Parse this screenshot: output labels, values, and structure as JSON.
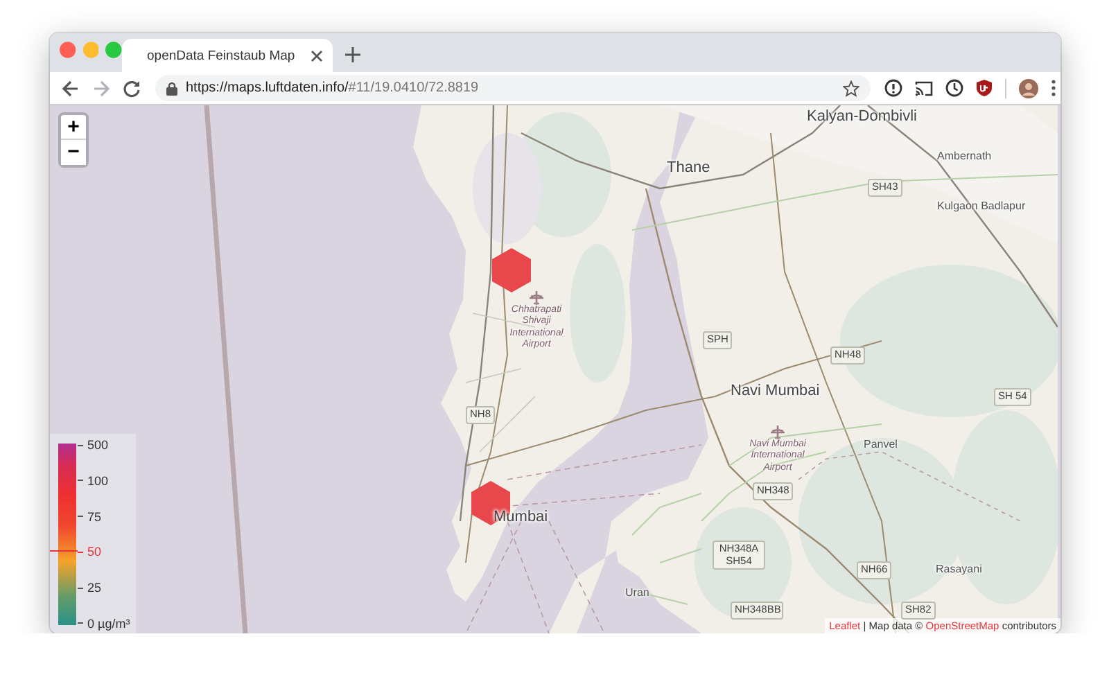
{
  "window": {
    "tab_title": "openData Feinstaub Map",
    "url_host": "https://maps.luftdaten.info/",
    "url_path": "#11/19.0410/72.8819"
  },
  "nav_buttons": [
    {
      "kind": "back",
      "disabled": false
    },
    {
      "kind": "forward",
      "disabled": true
    },
    {
      "kind": "reload",
      "disabled": false
    }
  ],
  "map": {
    "zoom_in": "+",
    "zoom_out": "−",
    "places": [
      {
        "kind": "city",
        "text": "Kalyan-Dombivli"
      },
      {
        "kind": "city",
        "text": "Thane"
      },
      {
        "kind": "town",
        "text": "Ambernath"
      },
      {
        "kind": "road",
        "text": "SH43"
      },
      {
        "kind": "town",
        "text": "Kulgaon Badlapur"
      },
      {
        "kind": "airport",
        "text": "Chhatrapati Shivaji International Airport"
      },
      {
        "kind": "road",
        "text": "SPH"
      },
      {
        "kind": "road",
        "text": "NH48"
      },
      {
        "kind": "city",
        "text": "Navi Mumbai"
      },
      {
        "kind": "road",
        "text": "SH 54"
      },
      {
        "kind": "road",
        "text": "NH8"
      },
      {
        "kind": "town",
        "text": "Panvel"
      },
      {
        "kind": "airport",
        "text": "Navi Mumbai International Airport"
      },
      {
        "kind": "road",
        "text": "NH348"
      },
      {
        "kind": "city",
        "text": "Mumbai"
      },
      {
        "kind": "road",
        "text": "NH348A SH54"
      },
      {
        "kind": "town",
        "text": "Uran"
      },
      {
        "kind": "road",
        "text": "NH66"
      },
      {
        "kind": "town",
        "text": "Rasayani"
      },
      {
        "kind": "road",
        "text": "NH348BB"
      },
      {
        "kind": "road",
        "text": "SH82"
      }
    ],
    "markers": [
      {
        "color": "#e8474c"
      },
      {
        "color": "#e8474c"
      }
    ],
    "legend": {
      "ticks": [
        {
          "label": "500",
          "selected": false
        },
        {
          "label": "100",
          "selected": false
        },
        {
          "label": "75",
          "selected": false
        },
        {
          "label": "50",
          "selected": true
        },
        {
          "label": "25",
          "selected": false
        },
        {
          "label": "0 µg/m³",
          "selected": false
        }
      ]
    },
    "attribution": [
      {
        "text": "Leaflet",
        "link": true
      },
      {
        "text": "| Map data ©",
        "link": false
      },
      {
        "text": "OpenStreetMap",
        "link": true
      },
      {
        "text": "contributors",
        "link": false
      }
    ]
  }
}
